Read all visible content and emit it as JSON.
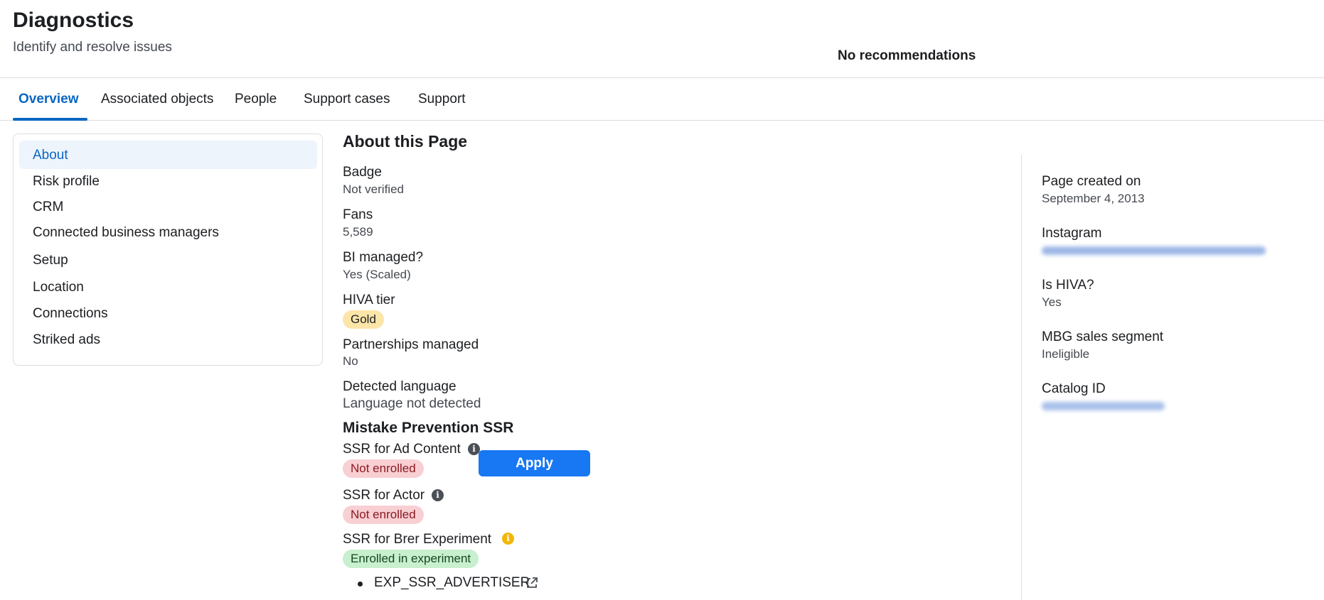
{
  "header": {
    "title": "Diagnostics",
    "subtitle": "Identify and resolve issues",
    "recommendations": "No recommendations"
  },
  "tabs": [
    {
      "label": "Overview",
      "active": true
    },
    {
      "label": "Associated objects"
    },
    {
      "label": "People"
    },
    {
      "label": "Support cases"
    },
    {
      "label": "Support"
    }
  ],
  "sidebar": {
    "items": [
      {
        "label": "About",
        "active": true
      },
      {
        "label": "Risk profile"
      },
      {
        "label": "CRM"
      },
      {
        "label": "Connected business managers"
      },
      {
        "label": "Setup"
      },
      {
        "label": "Location"
      },
      {
        "label": "Connections"
      },
      {
        "label": "Striked ads"
      }
    ]
  },
  "about": {
    "title": "About this Page",
    "badge": {
      "label": "Badge",
      "value": "Not verified"
    },
    "fans": {
      "label": "Fans",
      "value": "5,589"
    },
    "bi_managed": {
      "label": "BI managed?",
      "value": "Yes (Scaled)"
    },
    "hiva_tier": {
      "label": "HIVA tier",
      "value": "Gold"
    },
    "partnerships": {
      "label": "Partnerships managed",
      "value": "No"
    },
    "language": {
      "label": "Detected language",
      "value": "Language not detected"
    }
  },
  "ssr": {
    "title": "Mistake Prevention SSR",
    "ad_content": {
      "label": "SSR for Ad Content",
      "status": "Not enrolled"
    },
    "apply_label": "Apply",
    "actor": {
      "label": "SSR for Actor",
      "status": "Not enrolled"
    },
    "brer": {
      "label": "SSR for Brer Experiment",
      "status": "Enrolled in experiment"
    },
    "experiment_link": "EXP_SSR_ADVERTISER"
  },
  "right_panel": {
    "created": {
      "label": "Page created on",
      "value": "September 4, 2013"
    },
    "instagram": {
      "label": "Instagram"
    },
    "is_hiva": {
      "label": "Is HIVA?",
      "value": "Yes"
    },
    "mbg": {
      "label": "MBG sales segment",
      "value": "Ineligible"
    },
    "catalog": {
      "label": "Catalog ID"
    }
  },
  "colors": {
    "accent": "#0a66c2",
    "button": "#1877f2",
    "gold_pill": "#fbe5a8",
    "not_enrolled_pill": "#f8cfd3",
    "enrolled_pill": "#c8efce"
  },
  "icons": [
    "info-icon",
    "external-link-icon"
  ]
}
